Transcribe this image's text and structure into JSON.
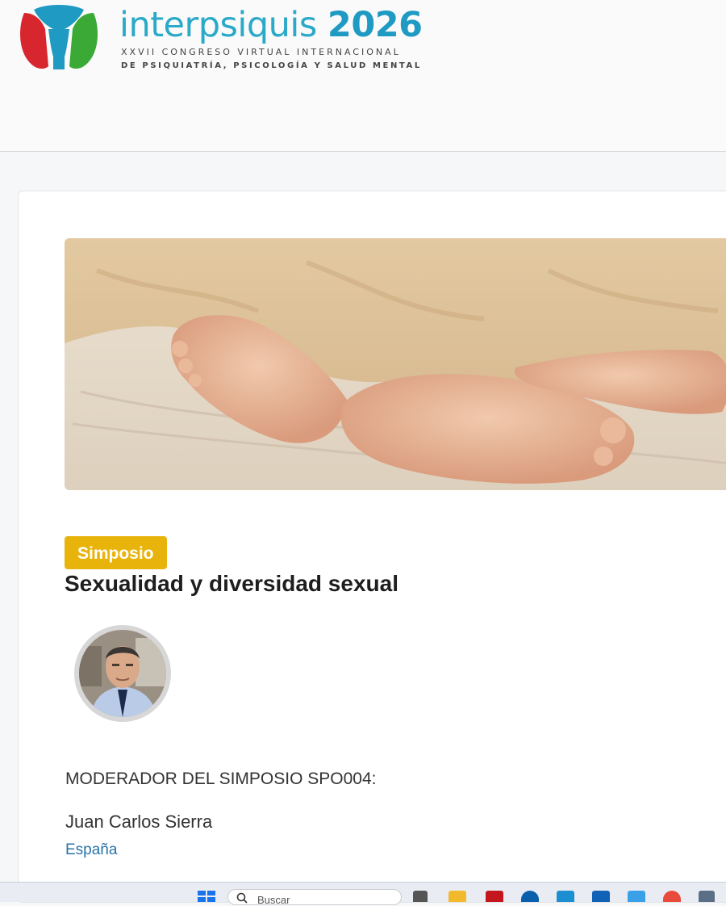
{
  "header": {
    "logo_name": "interpsiquis",
    "logo_year": "2026",
    "subtitle_line1": "XXVII CONGRESO VIRTUAL INTERNACIONAL",
    "subtitle_line2": "DE PSIQUIATRÍA, PSICOLOGÍA Y SALUD MENTAL",
    "colors": {
      "brand_blue": "#2ba9c9",
      "logo_red": "#d8262e",
      "logo_green": "#3aa935"
    }
  },
  "session": {
    "badge": "Simposio",
    "badge_color": "#e8b40c",
    "title": "Sexualidad y diversidad sexual",
    "role_text": "MODERADOR DEL SIMPOSIO SPO004:",
    "person_name": "Juan Carlos Sierra",
    "country": "España",
    "link_color": "#2a73a8"
  },
  "taskbar": {
    "search_placeholder": "Buscar",
    "icons": [
      "windows-start-icon",
      "search-icon",
      "task-view-icon",
      "file-explorer-icon",
      "app-icon-red",
      "hp-icon",
      "app-icon-blue",
      "outlook-icon",
      "app-icon-blue-2",
      "chrome-icon",
      "calculator-icon"
    ]
  }
}
